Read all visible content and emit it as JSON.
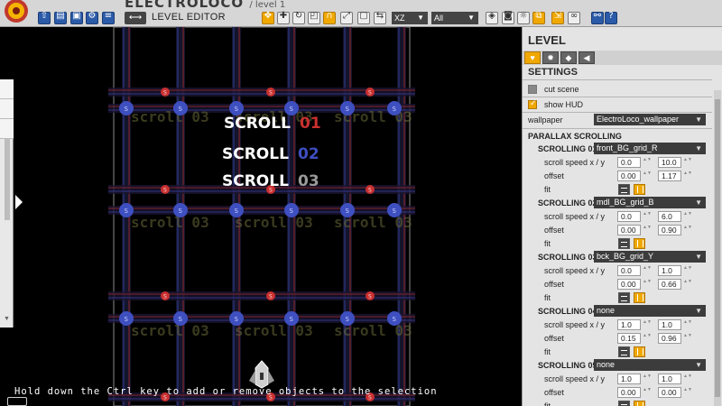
{
  "app": {
    "title": "ELECTROLOCO",
    "level_name": "/ level 1",
    "mode_label": "LEVEL EDITOR",
    "mode_arrows": "⟷"
  },
  "toolbar": {
    "axis_select": "XZ",
    "filter_select": "All",
    "help_label": "?",
    "buttons": [
      "upload",
      "save-as",
      "save",
      "settings",
      "hierarchy",
      "select",
      "move",
      "rotate",
      "scale",
      "snap",
      "snap-grid",
      "scale-box",
      "scale-frame",
      "flip",
      "camera",
      "camera-lock",
      "layers",
      "screenshot",
      "light",
      "orange-tool",
      "orange-tool-2",
      "link",
      "help"
    ]
  },
  "scene": {
    "scroll_labels": [
      {
        "text": "SCROLL",
        "num": "01",
        "color": "#c8302f"
      },
      {
        "text": "SCROLL",
        "num": "02",
        "color": "#3e4fc0"
      },
      {
        "text": "SCROLL",
        "num": "03",
        "color": "#9a9a9a"
      }
    ],
    "bg_text": "scroll 03",
    "status_message": "Hold down the Ctrl key to add or remove objects to the selection",
    "marker_letter": "S"
  },
  "panel": {
    "title": "LEVEL",
    "tabs": [
      "heart-icon",
      "sun-icon",
      "gem-icon",
      "speaker-icon"
    ],
    "settings_title": "SETTINGS",
    "cut_scene": {
      "label": "cut scene",
      "checked": false
    },
    "show_hud": {
      "label": "show HUD",
      "checked": true
    },
    "wallpaper": {
      "label": "wallpaper",
      "value": "ElectroLoco_wallpaper"
    },
    "parallax_title": "PARALLAX SCROLLING",
    "speed_label": "scroll speed x / y",
    "offset_label": "offset",
    "fit_label": "fit",
    "scrollings": [
      {
        "label": "SCROLLING 01",
        "value": "front_BG_grid_R",
        "speed_x": "0.0",
        "speed_y": "10.0",
        "offset_x": "0.00",
        "offset_y": "1.17"
      },
      {
        "label": "SCROLLING 02",
        "value": "mdl_BG_grid_B",
        "speed_x": "0.0",
        "speed_y": "6.0",
        "offset_x": "0.00",
        "offset_y": "0.90"
      },
      {
        "label": "SCROLLING 03",
        "value": "bck_BG_grid_Y",
        "speed_x": "0.0",
        "speed_y": "1.0",
        "offset_x": "0.00",
        "offset_y": "0.66"
      },
      {
        "label": "SCROLLING 04",
        "value": "none",
        "speed_x": "1.0",
        "speed_y": "1.0",
        "offset_x": "0.15",
        "offset_y": "0.96"
      },
      {
        "label": "SCROLLING 05",
        "value": "none",
        "speed_x": "1.0",
        "speed_y": "1.0",
        "offset_x": "0.00",
        "offset_y": "0.00"
      }
    ]
  },
  "colors": {
    "accent": "#f0a800",
    "toolbar_blue": "#2b5ba8",
    "grid_red": "#c8302f",
    "grid_blue": "#3e4fc0"
  }
}
